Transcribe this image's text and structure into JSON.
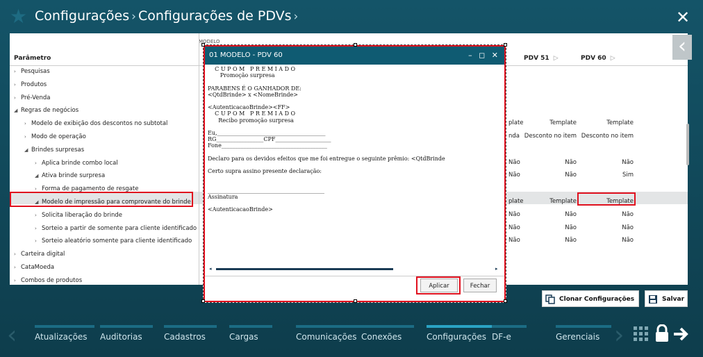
{
  "header": {
    "crumb1": "Configurações",
    "crumb2": "Configurações de PDVs",
    "sep": "›",
    "close": "✕",
    "back_arrow": "‹",
    "star_icon": "★"
  },
  "grid": {
    "param_header": "Parâmetro",
    "top_label": "MODELO",
    "pdv_cols": [
      "PDV 51",
      "PDV 60"
    ],
    "tree": [
      {
        "label": "Pesquisas",
        "level": 0,
        "tw": "›"
      },
      {
        "label": "Produtos",
        "level": 0,
        "tw": "›"
      },
      {
        "label": "Pré-Venda",
        "level": 0,
        "tw": "›"
      },
      {
        "label": "Regras de negócios",
        "level": 0,
        "tw": "◢"
      },
      {
        "label": "Modelo de exibição dos descontos no subtotal",
        "level": 1,
        "tw": "›"
      },
      {
        "label": "Modo de operação",
        "level": 1,
        "tw": "›"
      },
      {
        "label": "Brindes surpresas",
        "level": 1,
        "tw": "◢"
      },
      {
        "label": "Aplica brinde combo local",
        "level": 2,
        "tw": "›"
      },
      {
        "label": "Ativa brinde surpresa",
        "level": 2,
        "tw": "◢"
      },
      {
        "label": "Forma de pagamento de resgate",
        "level": 2,
        "tw": "›"
      },
      {
        "label": "Modelo de impressão para comprovante do brinde",
        "level": 2,
        "tw": "◢"
      },
      {
        "label": "Solicita liberação do brinde",
        "level": 2,
        "tw": "›"
      },
      {
        "label": "Sorteio a partir de somente para cliente identificado",
        "level": 2,
        "tw": "›"
      },
      {
        "label": "Sorteio aleatório somente para cliente identificado",
        "level": 2,
        "tw": "›"
      },
      {
        "label": "Carteira digital",
        "level": 0,
        "tw": "›"
      },
      {
        "label": "CataMoeda",
        "level": 0,
        "tw": "›"
      },
      {
        "label": "Combos de produtos",
        "level": 0,
        "tw": "›"
      }
    ],
    "values": [
      {
        "row": 4,
        "partial": "plate",
        "pdv51": "Template",
        "pdv60": "Template"
      },
      {
        "row": 5,
        "partial": "nda",
        "pdv51": "Desconto no item",
        "pdv60": "Desconto no item"
      },
      {
        "row": 7,
        "partial": "Não",
        "pdv51": "Não",
        "pdv60": "Não"
      },
      {
        "row": 8,
        "partial": "Não",
        "pdv51": "Não",
        "pdv60": "Sim"
      },
      {
        "row": 10,
        "partial": "plate",
        "pdv51": "Template",
        "pdv60": "Template"
      },
      {
        "row": 11,
        "partial": "Não",
        "pdv51": "Não",
        "pdv60": "Não"
      },
      {
        "row": 12,
        "partial": "Não",
        "pdv51": "Não",
        "pdv60": "Não"
      },
      {
        "row": 13,
        "partial": "Não",
        "pdv51": "Não",
        "pdv60": "Não"
      }
    ]
  },
  "actions": {
    "clone_label": "Clonar Configurações",
    "save_label": "Salvar"
  },
  "modal": {
    "title": "01 MODELO - PDV 60",
    "controls": "– ◻ ✕",
    "lines": [
      "    C U P O M   P R E M I A D O",
      "       Promoção surpresa",
      "",
      "PARABENS É O GANHADOR DE:",
      "<QtdBrinde> x <NomeBrinde>",
      "",
      "<AutenticacaoBrinde><FF>",
      "    C U P O M   P R E M I A D O",
      "      Recibo promoção surpresa",
      "",
      "Eu,_______________________________________",
      "RG_________________CPF____________________",
      "Fone______________________________________",
      "",
      "Declaro para os devidos efeitos que me foi entregue o seguinte prêmio: <QtdBrinde",
      "",
      "Certo supra assino presente declaração:",
      "",
      "",
      "__________________________________________",
      "Assinatura",
      "",
      "<AutenticacaoBrinde>"
    ],
    "apply": "Aplicar",
    "close": "Fechar"
  },
  "tabs": [
    {
      "label": "Atualizações",
      "active": false
    },
    {
      "label": "Auditorias",
      "active": false
    },
    {
      "label": "Cadastros",
      "active": false
    },
    {
      "label": "Cargas",
      "active": false
    },
    {
      "label": "Comunicações",
      "active": false
    },
    {
      "label": "Conexões",
      "active": false
    },
    {
      "label": "Configurações",
      "active": true
    },
    {
      "label": "DF-e",
      "active": false
    },
    {
      "label": "Gerenciais",
      "active": false
    }
  ],
  "colors": {
    "highlight": "#e0101e",
    "accent": "#2aa3c4",
    "title_bg": "#0f5b72"
  },
  "icons": {
    "apps": "grid-icon",
    "lock": "lock-icon",
    "exit": "arrow-right-icon"
  }
}
